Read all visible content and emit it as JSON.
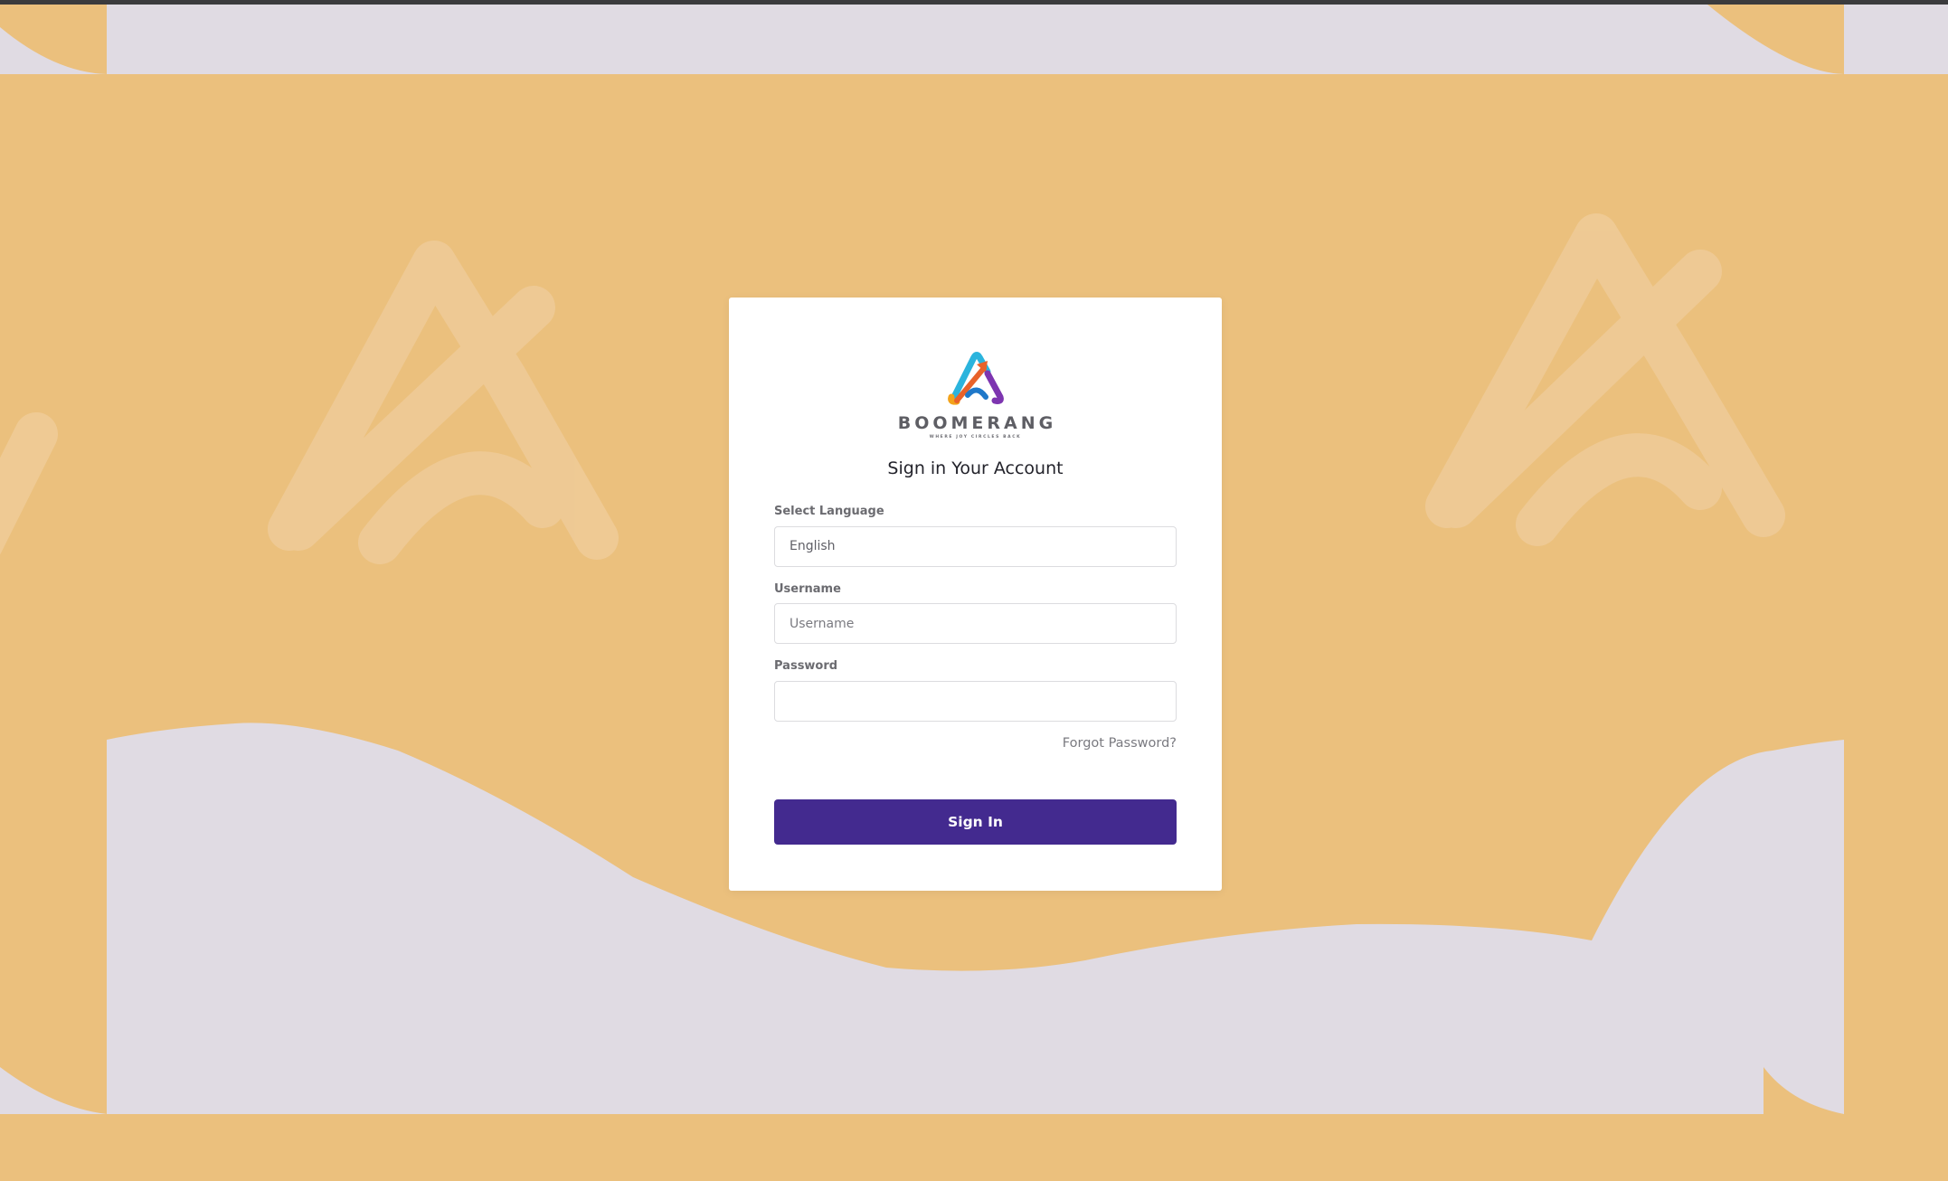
{
  "brand": {
    "name": "BOOMERANG",
    "tagline": "WHERE JOY CIRCLES BACK"
  },
  "form": {
    "heading": "Sign in Your Account",
    "language": {
      "label": "Select Language",
      "selected": "English"
    },
    "username": {
      "label": "Username",
      "placeholder": "Username",
      "value": ""
    },
    "password": {
      "label": "Password",
      "value": ""
    },
    "forgot_link": "Forgot Password?",
    "submit_label": "Sign In"
  },
  "colors": {
    "background_orange": "#ebc07d",
    "background_lavender": "#e0dbe3",
    "primary_button": "#432a8f",
    "card": "#ffffff"
  }
}
